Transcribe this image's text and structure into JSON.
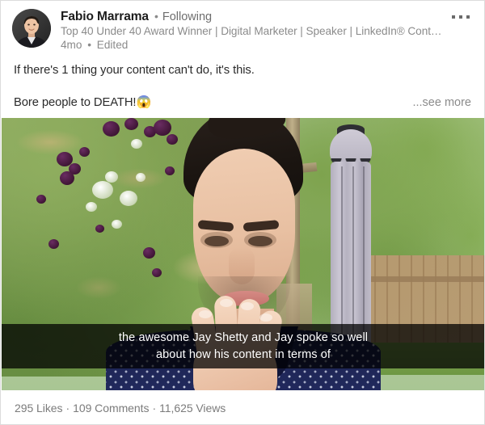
{
  "post": {
    "author": {
      "name": "Fabio Marrama",
      "following_separator": "•",
      "following_label": "Following",
      "headline": "Top 40 Under 40 Award Winner | Digital Marketer | Speaker | LinkedIn® Cont…",
      "avatar_icon": "user-avatar"
    },
    "meta": {
      "timestamp": "4mo",
      "separator": "•",
      "edited_label": "Edited"
    },
    "overflow_menu_icon": "ellipsis-icon",
    "text": {
      "line_1": "If there's 1 thing your content can't do, it's this.",
      "line_2": "Bore people to DEATH!",
      "line_2_emoji": "😱",
      "see_more_label": "...see more"
    },
    "media": {
      "type": "video",
      "scene_description": "man outdoors in a garden speaking to camera",
      "caption_line_1": "the awesome Jay Shetty and Jay spoke so well",
      "caption_line_2": "about how his content in terms of"
    },
    "stats": {
      "likes": "295 Likes",
      "comments": "109 Comments",
      "views": "11,625 Views",
      "separator": "·"
    }
  },
  "colors": {
    "card_border": "#dcdcdc",
    "card_background": "#ffffff",
    "primary_text": "#2b2b2b",
    "secondary_text": "#8b8b8b",
    "stats_text": "#7b7b7b",
    "caption_background": "rgba(0,0,0,0.74)",
    "caption_text": "#ffffff",
    "shirt_navy": "#1c2352",
    "umbrella_gray": "#c0bcc9",
    "foliage_green": "#7aa34c",
    "blossom_purple": "#3d1433"
  }
}
